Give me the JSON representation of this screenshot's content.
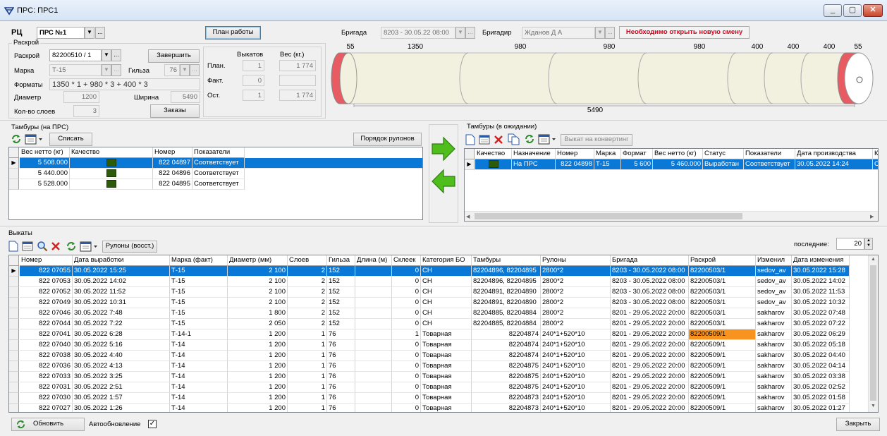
{
  "window": {
    "title": "ПРС: ПРС1",
    "min": "_",
    "max": "▢",
    "close": "✕"
  },
  "header": {
    "rc_label": "РЦ",
    "rc_value": "ПРС №1",
    "plan_button": "План работы",
    "brigade_label": "Бригада",
    "brigade_value": "8203 - 30.05.22 08:00",
    "foreman_label": "Бригадир",
    "foreman_value": "Жданов Д А",
    "warning": "Необходимо открыть новую смену"
  },
  "cut": {
    "group_label": "Раскрой",
    "raskroi_label": "Раскрой",
    "raskroi_value": "82200510 / 1",
    "finish_button": "Завершить",
    "marka_label": "Марка",
    "marka_value": "Т-15",
    "gilza_label": "Гильза",
    "gilza_value": "76",
    "formats_label": "Форматы",
    "formats_value": "1350 * 1 + 980 * 3 + 400 * 3",
    "diam_label": "Диаметр",
    "diam_value": "1200",
    "width_label": "Ширина",
    "width_value": "5490",
    "layers_label": "Кол-во слоев",
    "layers_value": "3",
    "orders_button": "Заказы",
    "stats": {
      "col1": "Выкатов",
      "col2": "Вес (кг.)",
      "row_plan": "План.",
      "row_fact": "Факт.",
      "row_rest": "Ост.",
      "plan_count": "1",
      "plan_weight": "1 774",
      "fact_count": "0",
      "fact_weight": "",
      "rest_count": "1",
      "rest_weight": "1 774"
    }
  },
  "roll_diagram": {
    "top_labels": [
      "55",
      "1350",
      "980",
      "980",
      "980",
      "400",
      "400",
      "400",
      "55"
    ],
    "total": "5490"
  },
  "drums_prs": {
    "label": "Тамбуры (на ПРС)",
    "write_off_button": "Списать",
    "order_button": "Порядок рулонов",
    "columns": [
      "Вес нетто (кг)",
      "Качество",
      "Номер",
      "Показатели"
    ],
    "rows": [
      {
        "weight": "5 508.000",
        "number": "822 04897",
        "status": "Соответствует"
      },
      {
        "weight": "5 440.000",
        "number": "822 04896",
        "status": "Соответствует"
      },
      {
        "weight": "5 528.000",
        "number": "822 04895",
        "status": "Соответствует"
      }
    ]
  },
  "drums_wait": {
    "label": "Тамбуры (в ожидании)",
    "converting_button": "Выкат на конвертинг",
    "columns": [
      "Качество",
      "Назначение",
      "Номер",
      "Марка",
      "Формат",
      "Вес нетто (кг)",
      "Статус",
      "Показатели",
      "Дата производства",
      "Кате"
    ],
    "rows": [
      {
        "dest": "На ПРС",
        "number": "822 04898",
        "marka": "Т-15",
        "format": "5 600",
        "weight": "5 460.000",
        "status": "Выработан",
        "indicators": "Соответствует",
        "date": "30.05.2022 14:24",
        "cat": "СН"
      }
    ]
  },
  "outputs": {
    "label": "Выкаты",
    "restore_button": "Рулоны (восст.)",
    "last_label": "последние:",
    "last_value": "20",
    "columns": [
      "Номер",
      "Дата выработки",
      "Марка (факт)",
      "Диаметр (мм)",
      "Слоев",
      "Гильза",
      "Длина (м)",
      "Склеек",
      "Категория БО",
      "Тамбуры",
      "Рулоны",
      "Бригада",
      "Раскрой",
      "Изменил",
      "Дата изменения"
    ],
    "rows": [
      [
        "822 07055",
        "30.05.2022 15:25",
        "Т-15",
        "2 100",
        "2",
        "152",
        "",
        "0",
        "СН",
        "82204896, 82204895",
        "2800*2",
        "8203 - 30.05.2022 08:00",
        "82200503/1",
        "sedov_av",
        "30.05.2022 15:28"
      ],
      [
        "822 07053",
        "30.05.2022 14:02",
        "Т-15",
        "2 100",
        "2",
        "152",
        "",
        "0",
        "СН",
        "82204896, 82204895",
        "2800*2",
        "8203 - 30.05.2022 08:00",
        "82200503/1",
        "sedov_av",
        "30.05.2022 14:02"
      ],
      [
        "822 07052",
        "30.05.2022 11:52",
        "Т-15",
        "2 100",
        "2",
        "152",
        "",
        "0",
        "СН",
        "82204891, 82204890",
        "2800*2",
        "8203 - 30.05.2022 08:00",
        "82200503/1",
        "sedov_av",
        "30.05.2022 11:53"
      ],
      [
        "822 07049",
        "30.05.2022 10:31",
        "Т-15",
        "2 100",
        "2",
        "152",
        "",
        "0",
        "СН",
        "82204891, 82204890",
        "2800*2",
        "8203 - 30.05.2022 08:00",
        "82200503/1",
        "sedov_av",
        "30.05.2022 10:32"
      ],
      [
        "822 07046",
        "30.05.2022 7:48",
        "Т-15",
        "1 800",
        "2",
        "152",
        "",
        "0",
        "СН",
        "82204885, 82204884",
        "2800*2",
        "8201 - 29.05.2022 20:00",
        "82200503/1",
        "sakharov",
        "30.05.2022 07:48"
      ],
      [
        "822 07044",
        "30.05.2022 7:22",
        "Т-15",
        "2 050",
        "2",
        "152",
        "",
        "0",
        "СН",
        "82204885, 82204884",
        "2800*2",
        "8201 - 29.05.2022 20:00",
        "82200503/1",
        "sakharov",
        "30.05.2022 07:22"
      ],
      [
        "822 07041",
        "30.05.2022 6:28",
        "Т-14-1",
        "1 200",
        "1",
        "76",
        "",
        "1",
        "Товарная",
        "82204874",
        "240*1+520*10",
        "8201 - 29.05.2022 20:00",
        "82200509/1",
        "sakharov",
        "30.05.2022 06:29"
      ],
      [
        "822 07040",
        "30.05.2022 5:16",
        "Т-14",
        "1 200",
        "1",
        "76",
        "",
        "0",
        "Товарная",
        "82204874",
        "240*1+520*10",
        "8201 - 29.05.2022 20:00",
        "82200509/1",
        "sakharov",
        "30.05.2022 05:18"
      ],
      [
        "822 07038",
        "30.05.2022 4:40",
        "Т-14",
        "1 200",
        "1",
        "76",
        "",
        "0",
        "Товарная",
        "82204874",
        "240*1+520*10",
        "8201 - 29.05.2022 20:00",
        "82200509/1",
        "sakharov",
        "30.05.2022 04:40"
      ],
      [
        "822 07036",
        "30.05.2022 4:13",
        "Т-14",
        "1 200",
        "1",
        "76",
        "",
        "0",
        "Товарная",
        "82204875",
        "240*1+520*10",
        "8201 - 29.05.2022 20:00",
        "82200509/1",
        "sakharov",
        "30.05.2022 04:14"
      ],
      [
        "822 07033",
        "30.05.2022 3:25",
        "Т-14",
        "1 200",
        "1",
        "76",
        "",
        "0",
        "Товарная",
        "82204875",
        "240*1+520*10",
        "8201 - 29.05.2022 20:00",
        "82200509/1",
        "sakharov",
        "30.05.2022 03:38"
      ],
      [
        "822 07031",
        "30.05.2022 2:51",
        "Т-14",
        "1 200",
        "1",
        "76",
        "",
        "0",
        "Товарная",
        "82204875",
        "240*1+520*10",
        "8201 - 29.05.2022 20:00",
        "82200509/1",
        "sakharov",
        "30.05.2022 02:52"
      ],
      [
        "822 07030",
        "30.05.2022 1:57",
        "Т-14",
        "1 200",
        "1",
        "76",
        "",
        "0",
        "Товарная",
        "82204873",
        "240*1+520*10",
        "8201 - 29.05.2022 20:00",
        "82200509/1",
        "sakharov",
        "30.05.2022 01:58"
      ],
      [
        "822 07027",
        "30.05.2022 1:26",
        "Т-14",
        "1 200",
        "1",
        "76",
        "",
        "0",
        "Товарная",
        "82204873",
        "240*1+520*10",
        "8201 - 29.05.2022 20:00",
        "82200509/1",
        "sakharov",
        "30.05.2022 01:27"
      ]
    ],
    "highlight": {
      "row": 6,
      "col": 12,
      "color": "#f7931e"
    }
  },
  "footer": {
    "refresh_button": "Обновить",
    "auto_label": "Автообновление",
    "close_button": "Закрыть"
  },
  "colors": {
    "selection": "#0a78d7",
    "warning_text": "#e0001a",
    "quality": "#2d5a0b",
    "arrow": "#4fbe1d",
    "roll_end": "#e85b63"
  }
}
